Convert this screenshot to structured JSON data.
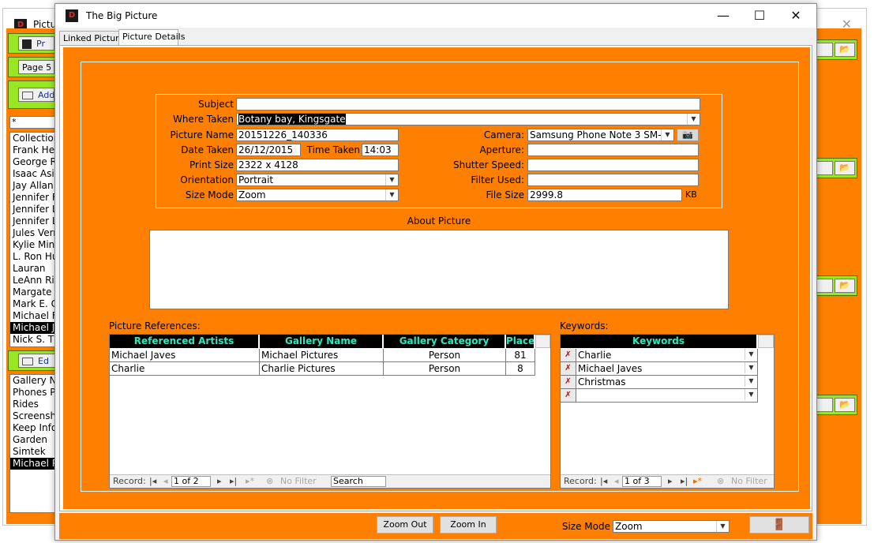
{
  "background_window": {
    "title": "Pictu",
    "buttons": [
      "Pr",
      "Page 5",
      "Add"
    ],
    "filter_value": "*",
    "people_list": [
      "Collection",
      "Frank Her",
      "George R.",
      "Isaac Asin",
      "Jay Allan",
      "Jennifer F",
      "Jennifer L",
      "Jennifer L",
      "Jules Verr",
      "Kylie Mino",
      "L. Ron Hu",
      "Lauran",
      "LeAnn Rin",
      "Margate C",
      "Mark E. C",
      "Michael Fl",
      "Michael Ja",
      "Nick S. Th"
    ],
    "edit_button": "Ed",
    "gallery_list": [
      "Gallery Na",
      "Phones P",
      "Rides",
      "Screensh",
      "Keep Info",
      "Garden",
      "Simtek",
      "Michael P"
    ]
  },
  "window": {
    "title": "The Big Picture",
    "controls": {
      "minimize": "—",
      "maximize": "☐",
      "close": "✕"
    }
  },
  "tabs": [
    {
      "label": "Linked Picture"
    },
    {
      "label": "Picture Details"
    }
  ],
  "details": {
    "subject": {
      "label": "Subject",
      "value": ""
    },
    "where_taken": {
      "label": "Where Taken",
      "value": "Botany bay, Kingsgate"
    },
    "picture_name": {
      "label": "Picture Name",
      "value": "20151226_140336"
    },
    "date_taken": {
      "label": "Date Taken",
      "value": "26/12/2015"
    },
    "time_taken": {
      "label": "Time Taken",
      "value": "14:03"
    },
    "print_size": {
      "label": "Print Size",
      "value": "2322 x 4128"
    },
    "orientation": {
      "label": "Orientation",
      "value": "Portrait"
    },
    "size_mode": {
      "label": "Size Mode",
      "value": "Zoom"
    },
    "camera": {
      "label": "Camera:",
      "value": "Samsung Phone Note 3 SM-N9"
    },
    "aperture": {
      "label": "Aperture:",
      "value": ""
    },
    "shutter_speed": {
      "label": "Shutter Speed:",
      "value": ""
    },
    "filter_used": {
      "label": "Filter Used:",
      "value": ""
    },
    "file_size": {
      "label": "File Size",
      "value": "2999.8",
      "unit": "KB"
    }
  },
  "about": {
    "label": "About Picture",
    "value": ""
  },
  "references": {
    "label": "Picture References:",
    "columns": [
      "Referenced Artists",
      "Gallery Name",
      "Gallery Category",
      "Place"
    ],
    "rows": [
      [
        "Michael Javes",
        "Michael Pictures",
        "Person",
        "81"
      ],
      [
        "Charlie",
        "Charlie Pictures",
        "Person",
        "8"
      ]
    ],
    "nav": {
      "record_label": "Record:",
      "position": "1 of 2",
      "filter": "No Filter",
      "search": "Search"
    }
  },
  "keywords": {
    "label": "Keywords:",
    "column": "Keywords",
    "rows": [
      "Charlie",
      "Michael Javes",
      "Christmas",
      ""
    ],
    "nav": {
      "record_label": "Record:",
      "position": "1 of 3",
      "filter": "No Filter"
    }
  },
  "bottom": {
    "zoom_out": "Zoom Out",
    "zoom_in": "Zoom In",
    "size_mode_label": "Size Mode",
    "size_mode_value": "Zoom"
  },
  "colors": {
    "panel": "#ff8000",
    "header_text": "#2ee8c0",
    "accent_green": "#99e625"
  }
}
